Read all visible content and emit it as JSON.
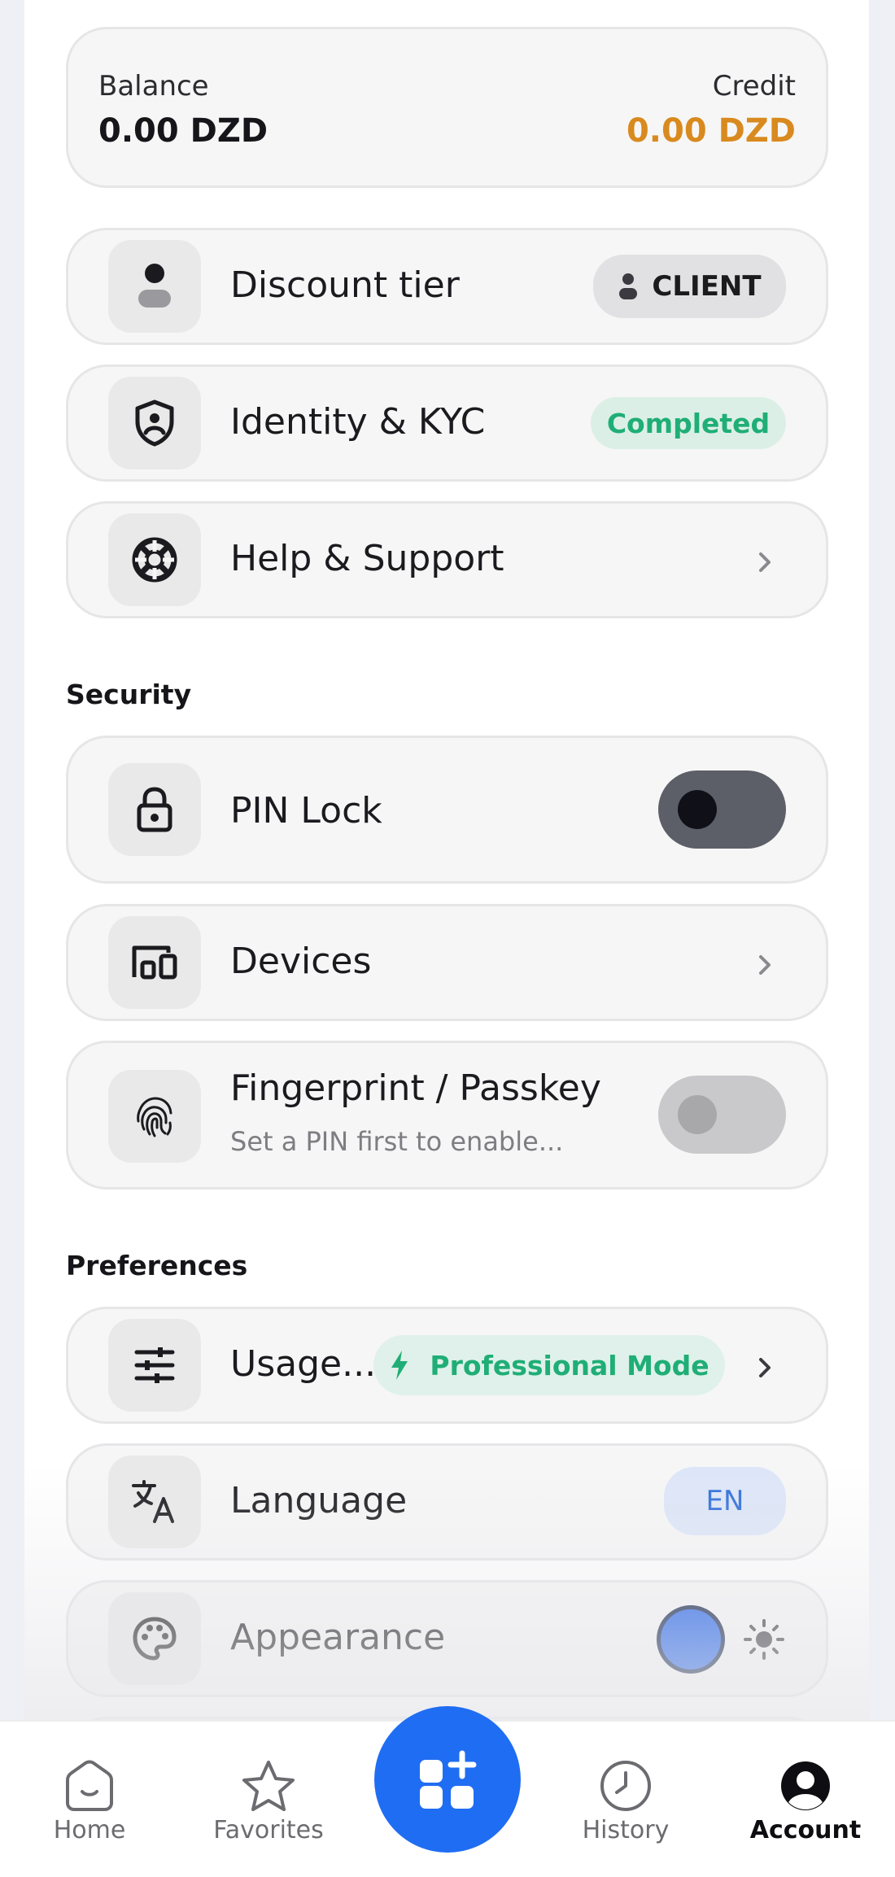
{
  "balance_card": {
    "balance_label": "Balance",
    "balance_value": "0.00 DZD",
    "credit_label": "Credit",
    "credit_value": "0.00 DZD"
  },
  "account_rows": [
    {
      "label": "Discount tier",
      "icon": "person-icon",
      "badge": "CLIENT",
      "badge_icon": "person-icon"
    },
    {
      "label": "Identity & KYC",
      "icon": "shield-person-icon",
      "badge": "Completed"
    },
    {
      "label": "Help & Support",
      "icon": "lifebuoy-icon",
      "accessory": "chevron-right-icon"
    }
  ],
  "security": {
    "title": "Security",
    "pin_lock": {
      "label": "PIN Lock",
      "icon": "lock-icon",
      "toggle_on": false
    },
    "devices": {
      "label": "Devices",
      "icon": "devices-icon",
      "accessory": "chevron-right-icon"
    },
    "fingerprint": {
      "label": "Fingerprint / Passkey",
      "sublabel": "Set a PIN first to enable...",
      "icon": "fingerprint-icon",
      "toggle_on": false,
      "disabled": true
    }
  },
  "preferences": {
    "title": "Preferences",
    "usage": {
      "label": "Usage...",
      "icon": "sliders-icon",
      "badge": "Professional Mode",
      "badge_icon": "bolt-icon"
    },
    "language": {
      "label": "Language",
      "icon": "translate-icon",
      "badge": "EN"
    },
    "appearance": {
      "label": "Appearance",
      "icon": "palette-icon",
      "accent_color": "#1f5fe8",
      "theme_icon": "sun-icon"
    }
  },
  "bottom_nav": {
    "items": [
      {
        "label": "Home",
        "icon": "home-icon",
        "active": false
      },
      {
        "label": "Favorites",
        "icon": "star-icon",
        "active": false
      },
      {
        "label": "History",
        "icon": "clock-icon",
        "active": false
      },
      {
        "label": "Account",
        "icon": "account-icon",
        "active": true
      }
    ],
    "fab_icon": "grid-plus-icon"
  },
  "colors": {
    "accent": "#1f6df2",
    "credit": "#d98a1e",
    "success": "#1fae76",
    "success_bg": "#dcefe6",
    "language_bg": "#dde6f8",
    "language_text": "#2f6fd8"
  }
}
